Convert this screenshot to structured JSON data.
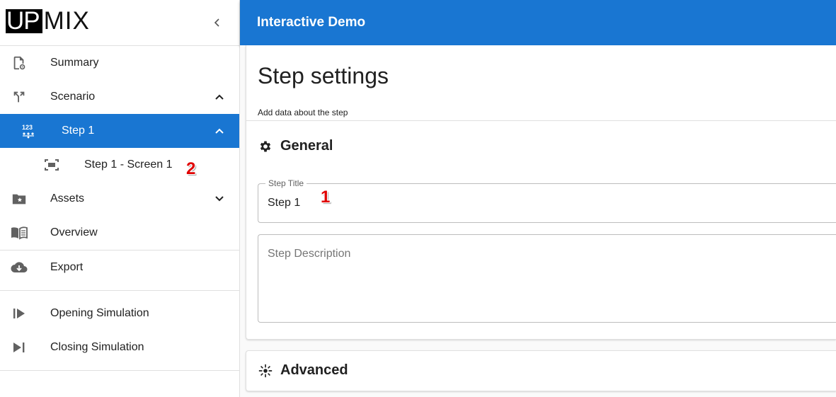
{
  "brand": {
    "logo_left": "UP",
    "logo_right": "MIX"
  },
  "header": {
    "title": "Interactive Demo"
  },
  "sidebar": {
    "items": [
      {
        "label": "Summary",
        "icon": "file-settings-icon"
      },
      {
        "label": "Scenario",
        "icon": "split-arrows-icon",
        "expanded": true
      },
      {
        "label": "Step 1",
        "icon": "numbered-list-icon",
        "active": true,
        "expanded": true
      },
      {
        "label": "Step 1 - Screen 1",
        "icon": "screen-frame-icon"
      },
      {
        "label": "Assets",
        "icon": "folder-star-icon",
        "expanded": false
      },
      {
        "label": "Overview",
        "icon": "open-book-icon"
      },
      {
        "label": "Export",
        "icon": "cloud-download-icon"
      },
      {
        "label": "Opening Simulation",
        "icon": "play-start-icon"
      },
      {
        "label": "Closing Simulation",
        "icon": "play-end-icon"
      }
    ]
  },
  "main": {
    "title": "Step settings",
    "subtitle": "Add data about the step",
    "general": {
      "label": "General",
      "icon": "gear-icon",
      "step_title_label": "Step Title",
      "step_title_value": "Step 1",
      "step_description_placeholder": "Step Description"
    },
    "advanced": {
      "label": "Advanced",
      "icon": "sparkle-icon"
    }
  },
  "markers": {
    "one": "1",
    "two": "2"
  },
  "colors": {
    "accent": "#1976d2",
    "marker": "#e00000"
  }
}
